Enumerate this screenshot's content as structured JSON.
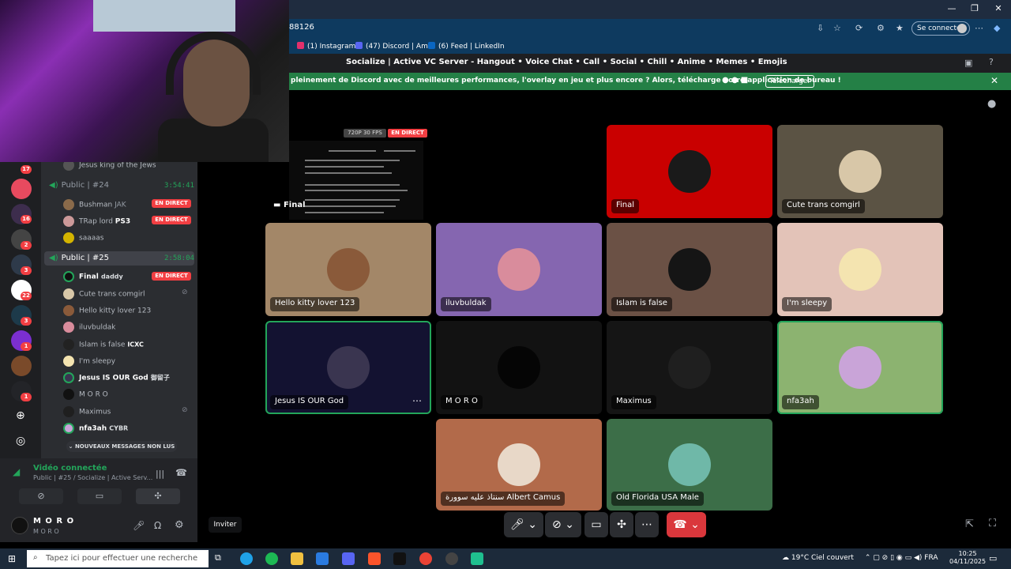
{
  "browser": {
    "url_fragment": "88126",
    "connect_label": "Se connecter",
    "bookmarks": [
      {
        "label": "(1) Instagram",
        "color": "#e1306c"
      },
      {
        "label": "(47) Discord | Amis",
        "color": "#5865f2"
      },
      {
        "label": "(6) Feed | LinkedIn",
        "color": "#0a66c2"
      }
    ]
  },
  "server": {
    "title": "Socialize | Active VC Server - Hangout • Voice Chat • Call • Social • Chill • Anime • Memes • Emojis"
  },
  "banner": {
    "text": "pleinement de Discord avec de meilleures performances, l'overlay en jeu et plus encore ? Alors, télécharge notre application de bureau !",
    "download_label": "Télécharger"
  },
  "rail": {
    "badges": [
      "17",
      "16",
      "2",
      "3",
      "22",
      "3",
      "1",
      "1"
    ]
  },
  "channels": {
    "top_user": "Jesus king of the Jews",
    "ch24": {
      "name": "Public | #24",
      "timer": "3:54:41"
    },
    "ch24_users": [
      {
        "name": "Bushman",
        "extra": "JAK",
        "live": true
      },
      {
        "name": "TRap lord",
        "extra": "PS3",
        "live": true
      },
      {
        "name": "saaaas",
        "extra": "",
        "live": false
      }
    ],
    "ch25": {
      "name": "Public | #25",
      "timer": "2:58:04"
    },
    "ch25_users": [
      {
        "name": "Final",
        "extra": "daddy",
        "live": true
      },
      {
        "name": "Cute trans comgirl",
        "extra": "",
        "live": false
      },
      {
        "name": "Hello kitty lover 123",
        "extra": "",
        "live": false
      },
      {
        "name": "iluvbuldak",
        "extra": "",
        "live": false
      },
      {
        "name": "Islam is false",
        "extra": "ICXC",
        "live": false
      },
      {
        "name": "I'm sleepy",
        "extra": "",
        "live": false
      },
      {
        "name": "Jesus IS OUR God",
        "extra": "御留子",
        "live": false
      },
      {
        "name": "M O R O",
        "extra": "",
        "live": false
      },
      {
        "name": "Maximus",
        "extra": "",
        "live": false
      },
      {
        "name": "nfa3ah",
        "extra": "CYBR",
        "live": false
      }
    ],
    "live_label": "EN DIRECT",
    "new_messages": "NOUVEAUX MESSAGES NON LUS"
  },
  "voice_panel": {
    "title": "Vidéo connectée",
    "subtitle": "Public | #25 / Socialize | Active Serv..."
  },
  "user_panel": {
    "name": "M O R O",
    "status": "M O R O"
  },
  "stream": {
    "quality": "720P 30 FPS",
    "live_label": "EN DIRECT",
    "owner": "Final"
  },
  "tiles": [
    {
      "name": "Final",
      "bg": "#c90000",
      "av": "#1a1a1a",
      "speaking": false
    },
    {
      "name": "Cute trans comgirl",
      "bg": "#5b5344",
      "av": "#d8c7a8",
      "speaking": false
    },
    {
      "name": "Hello kitty lover 123",
      "bg": "#a38768",
      "av": "#8a5a3a",
      "speaking": false
    },
    {
      "name": "iluvbuldak",
      "bg": "#8566b0",
      "av": "#d98c9c",
      "speaking": false
    },
    {
      "name": "Islam is false",
      "bg": "#6b5145",
      "av": "#151515",
      "speaking": false
    },
    {
      "name": "I'm sleepy",
      "bg": "#e3c3b8",
      "av": "#f4e4b0",
      "speaking": false
    },
    {
      "name": "Jesus IS OUR God",
      "bg": "#131231",
      "av": "#3a3550",
      "speaking": true
    },
    {
      "name": "M O R O",
      "bg": "#121212",
      "av": "#050505",
      "speaking": false
    },
    {
      "name": "Maximus",
      "bg": "#151515",
      "av": "#1f1f1f",
      "speaking": false
    },
    {
      "name": "nfa3ah",
      "bg": "#8cb370",
      "av": "#c9a4d8",
      "speaking": true
    },
    {
      "name": "سنتاذ علیه سوورة Albert Camus",
      "bg": "#b26a4a",
      "av": "#e8d8c8",
      "speaking": false
    },
    {
      "name": "Old Florida USA Male",
      "bg": "#3c6e48",
      "av": "#6fb8a8",
      "speaking": false
    }
  ],
  "controls": {
    "invite": "Inviter"
  },
  "taskbar": {
    "search_placeholder": "Tapez ici pour effectuer une recherche",
    "weather": "19°C  Ciel couvert",
    "lang": "FRA",
    "time": "10:25",
    "date": "04/11/2025"
  }
}
